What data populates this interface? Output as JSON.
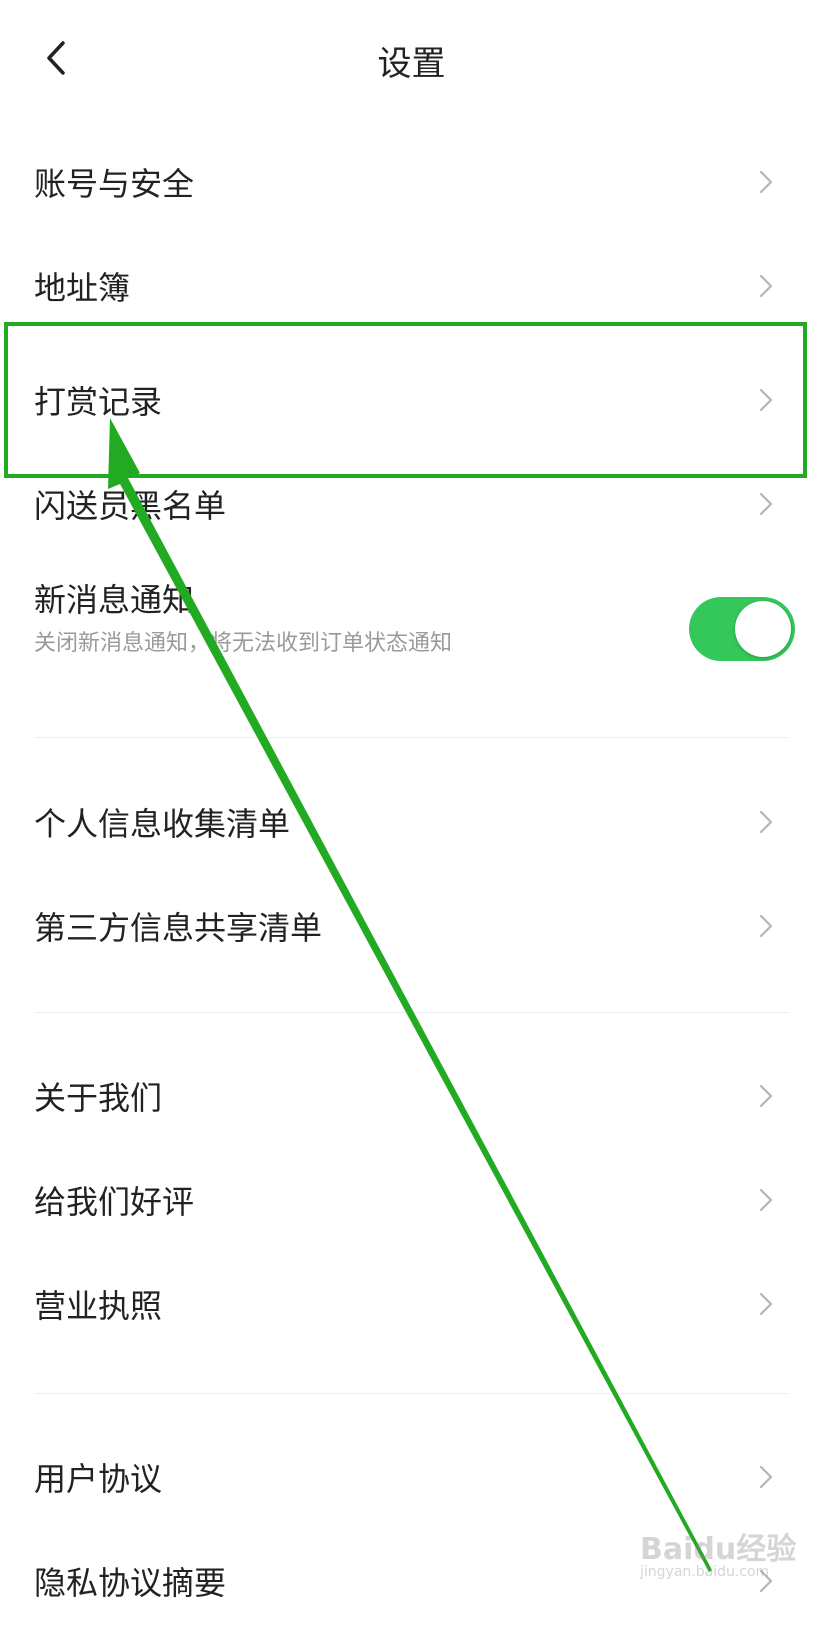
{
  "header": {
    "title": "设置",
    "back_icon": "chevron-left-icon"
  },
  "group1": {
    "items": [
      {
        "label": "账号与安全"
      },
      {
        "label": "地址簿"
      },
      {
        "label": "打赏记录"
      },
      {
        "label": "闪送员黑名单"
      }
    ]
  },
  "notification": {
    "title": "新消息通知",
    "subtitle": "关闭新消息通知，将无法收到订单状态通知",
    "enabled": true,
    "toggle_color": "#34c759"
  },
  "group2": {
    "items": [
      {
        "label": "个人信息收集清单"
      },
      {
        "label": "第三方信息共享清单"
      }
    ]
  },
  "group3": {
    "items": [
      {
        "label": "关于我们"
      },
      {
        "label": "给我们好评"
      },
      {
        "label": "营业执照"
      }
    ]
  },
  "group4": {
    "items": [
      {
        "label": "用户协议"
      },
      {
        "label": "隐私协议摘要"
      }
    ]
  },
  "annotation": {
    "color": "#22aa22"
  },
  "watermark": {
    "brand": "Baidu经验",
    "url": "jingyan.baidu.com"
  }
}
